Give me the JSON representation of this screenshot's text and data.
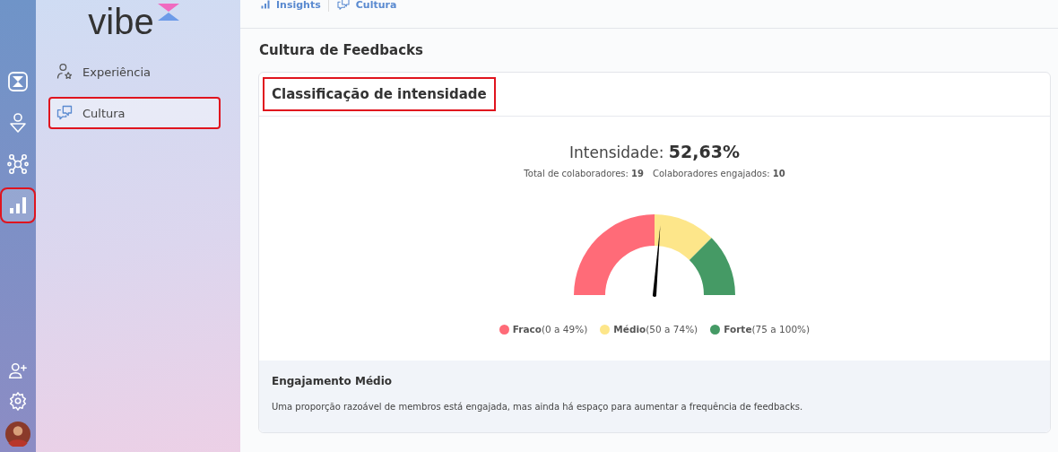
{
  "rail": {
    "items": [
      {
        "selected": false,
        "highlighted": false
      },
      {
        "selected": false,
        "highlighted": false
      },
      {
        "selected": false,
        "highlighted": false
      },
      {
        "selected": true,
        "highlighted": true
      }
    ]
  },
  "sidebar": {
    "logo": "vibe",
    "items": [
      {
        "label": "Experiência",
        "selected": false,
        "highlighted": false
      },
      {
        "label": "Cultura",
        "selected": true,
        "highlighted": true
      }
    ]
  },
  "breadcrumb": [
    {
      "label": "Insights"
    },
    {
      "label": "Cultura"
    }
  ],
  "page_title": "Cultura de Feedbacks",
  "card": {
    "title": "Classificação de intensidade",
    "title_highlighted": true,
    "intensity_label": "Intensidade:",
    "intensity_value": "52,63%",
    "stats": [
      {
        "label": "Total de colaboradores:",
        "value": "19"
      },
      {
        "label": "Colaboradores engajados:",
        "value": "10"
      }
    ],
    "gauge": {
      "level": 0.5263,
      "segments": [
        {
          "name": "Fraco",
          "range": "(0 a 49%)",
          "color": "#ff6b78"
        },
        {
          "name": "Médio",
          "range": "(50 a 74%)",
          "color": "#fde68a"
        },
        {
          "name": "Forte",
          "range": "(75 a 100%)",
          "color": "#459a65"
        }
      ]
    },
    "footer": {
      "title": "Engajamento Médio",
      "text": "Uma proporção razoável de membros está engajada, mas ainda há espaço para aumentar a frequência de feedbacks."
    }
  }
}
